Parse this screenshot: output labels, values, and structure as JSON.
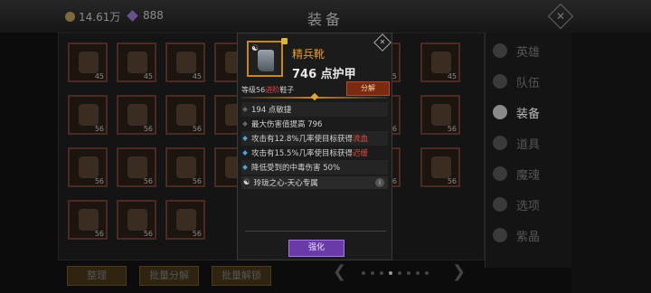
{
  "header": {
    "gold_value": "14.61万",
    "gems_value": "888",
    "title": "装备",
    "close_glyph": "✕"
  },
  "grid": {
    "slots": [
      {
        "qty": "45"
      },
      {
        "qty": "45"
      },
      {
        "qty": "45"
      },
      {
        "qty": ""
      },
      {
        "qty": ""
      },
      {
        "qty": ""
      },
      {
        "qty": "45",
        "qty2": "(3)"
      },
      {
        "qty": "45"
      },
      {
        "qty": "56"
      },
      {
        "qty": "56"
      },
      {
        "qty": "56"
      },
      {
        "qty": ""
      },
      {
        "qty": ""
      },
      {
        "qty": ""
      },
      {
        "qty": "56"
      },
      {
        "qty": "56"
      },
      {
        "qty": "56"
      },
      {
        "qty": "56"
      },
      {
        "qty": "56"
      },
      {
        "qty": ""
      },
      {
        "qty": ""
      },
      {
        "qty": ""
      },
      {
        "qty": "56"
      },
      {
        "qty": "56"
      },
      {
        "qty": "56"
      },
      {
        "qty": "56"
      },
      {
        "qty": "56"
      }
    ]
  },
  "sidebar": {
    "items": [
      {
        "label": "英雄",
        "icon": "hero-icon"
      },
      {
        "label": "队伍",
        "icon": "team-icon"
      },
      {
        "label": "装备",
        "icon": "equipment-icon",
        "active": true
      },
      {
        "label": "道具",
        "icon": "items-icon"
      },
      {
        "label": "魔魂",
        "icon": "soul-icon"
      },
      {
        "label": "选项",
        "icon": "gear-icon"
      },
      {
        "label": "紫晶",
        "icon": "crystal-icon"
      }
    ]
  },
  "footer": {
    "sort_label": "整理",
    "batch_decompose_label": "批量分解",
    "batch_unlock_label": "批量解锁",
    "prev_arrow": "❮",
    "next_arrow": "❯"
  },
  "popup": {
    "item_name": "精兵靴",
    "armor_text": "746 点护甲",
    "level_text": "等级56",
    "advanced_tag": "进阶",
    "type_text": "鞋子",
    "decompose_label": "分解",
    "stats": [
      {
        "pre": "194 点敏捷",
        "hl": "",
        "post": "",
        "bullet": "grey"
      },
      {
        "pre": "最大伤害值提高 796",
        "hl": "",
        "post": "",
        "bullet": "grey"
      },
      {
        "pre": "攻击有12.8%几率使目标获得",
        "hl": "流血",
        "post": "",
        "bullet": "blue"
      },
      {
        "pre": "攻击有15.5%几率使目标获得",
        "hl": "迟缓",
        "post": "",
        "bullet": "blue"
      },
      {
        "pre": "降低受到的中毒伤害 50%",
        "hl": "",
        "post": "",
        "bullet": "blue"
      }
    ],
    "set_text": "玲珑之心-天心专属",
    "set_icon_glyph": "☯",
    "info_glyph": "i",
    "strengthen_label": "强化"
  },
  "colors": {
    "accent_orange": "#e79a2c",
    "advanced_red": "#e04545",
    "strengthen_purple": "#6a3aa8",
    "bullet_blue": "#4aa3e0"
  }
}
